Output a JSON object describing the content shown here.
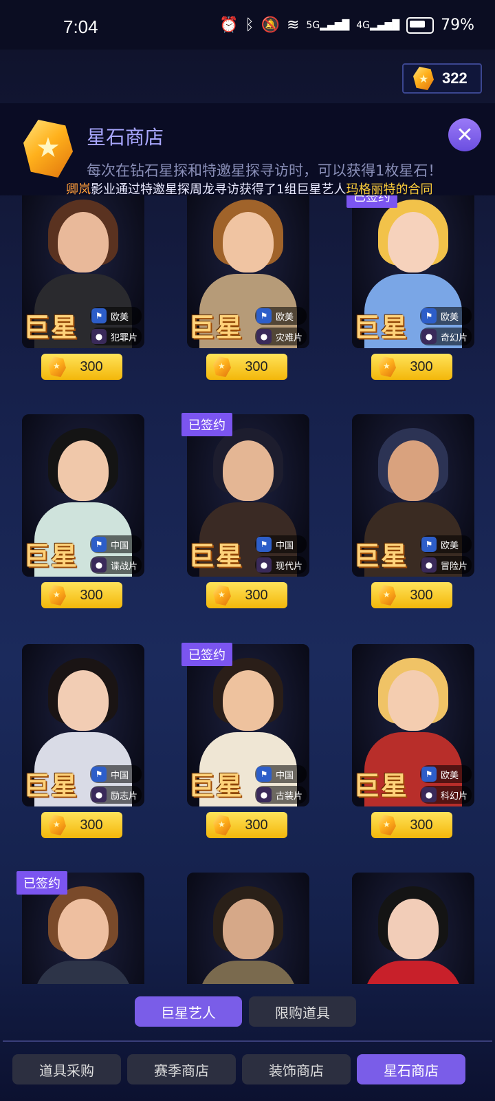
{
  "status_bar": {
    "time": "7:04",
    "net5g": "5G",
    "net4g": "4G",
    "battery": "79%"
  },
  "currency": {
    "icon": "star-gem-icon",
    "value": "322"
  },
  "banner": {
    "title": "星石商店",
    "description": "每次在钻石星探和特邀星探寻访时，可以获得1枚星石！",
    "close_icon": "close-icon"
  },
  "ticker": {
    "studio": "卿岚",
    "part1": "影业通过特邀星探周龙寻访获得了1组巨星艺人",
    "highlight": "玛格丽特的合同"
  },
  "cards": [
    {
      "tier": "巨星",
      "region": "欧美",
      "genre": "犯罪片",
      "price": "300",
      "signed": "",
      "colors": {
        "hair": "#5a3220",
        "skin": "#e9b99a",
        "body": "#2a2a2e"
      }
    },
    {
      "tier": "巨星",
      "region": "欧美",
      "genre": "灾难片",
      "price": "300",
      "signed": "",
      "colors": {
        "hair": "#a0632a",
        "skin": "#f0c4a2",
        "body": "#b69b78"
      }
    },
    {
      "tier": "巨星",
      "region": "欧美",
      "genre": "奇幻片",
      "price": "300",
      "signed": "已签约",
      "colors": {
        "hair": "#f2c24a",
        "skin": "#f6d2bc",
        "body": "#7aa6e6"
      }
    },
    {
      "tier": "巨星",
      "region": "中国",
      "genre": "谍战片",
      "price": "300",
      "signed": "",
      "colors": {
        "hair": "#141414",
        "skin": "#f0c8aa",
        "body": "#cfe3dc"
      }
    },
    {
      "tier": "巨星",
      "region": "中国",
      "genre": "现代片",
      "price": "300",
      "signed": "已签约",
      "colors": {
        "hair": "#1d1d2e",
        "skin": "#e4b694",
        "body": "#3a2a24"
      }
    },
    {
      "tier": "巨星",
      "region": "欧美",
      "genre": "冒险片",
      "price": "300",
      "signed": "",
      "colors": {
        "hair": "#2c3354",
        "skin": "#d9a27e",
        "body": "#3a2b22"
      }
    },
    {
      "tier": "巨星",
      "region": "中国",
      "genre": "励志片",
      "price": "300",
      "signed": "",
      "colors": {
        "hair": "#1a1414",
        "skin": "#f2cdb4",
        "body": "#d9dbe6"
      }
    },
    {
      "tier": "巨星",
      "region": "中国",
      "genre": "古装片",
      "price": "300",
      "signed": "已签约",
      "colors": {
        "hair": "#2a1e18",
        "skin": "#eec29e",
        "body": "#efe6d4"
      }
    },
    {
      "tier": "巨星",
      "region": "欧美",
      "genre": "科幻片",
      "price": "300",
      "signed": "",
      "colors": {
        "hair": "#f0c366",
        "skin": "#f4cdb0",
        "body": "#b82e2a"
      }
    },
    {
      "tier": "",
      "region": "",
      "genre": "",
      "price": "",
      "signed": "已签约",
      "colors": {
        "hair": "#7a4a2a",
        "skin": "#eebfa0",
        "body": "#2d3448"
      }
    },
    {
      "tier": "",
      "region": "",
      "genre": "",
      "price": "",
      "signed": "",
      "colors": {
        "hair": "#2a2018",
        "skin": "#d6a888",
        "body": "#7a6a4e"
      }
    },
    {
      "tier": "",
      "region": "",
      "genre": "",
      "price": "",
      "signed": "",
      "colors": {
        "hair": "#141414",
        "skin": "#f2cdb8",
        "body": "#c8202a"
      }
    }
  ],
  "sub_tabs": [
    "巨星艺人",
    "限购道具"
  ],
  "bottom_tabs": [
    "道具采购",
    "赛季商店",
    "装饰商店",
    "星石商店"
  ]
}
